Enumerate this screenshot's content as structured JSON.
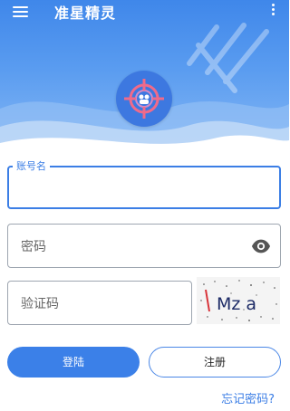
{
  "app": {
    "title": "准星精灵"
  },
  "icons": {
    "menu": "hamburger-menu-icon",
    "more": "more-vertical-icon",
    "logo": "crosshair-icon",
    "eye": "eye-icon"
  },
  "colors": {
    "primary": "#3b80e8",
    "header_top": "#3f87ea",
    "header_bottom": "#86b8f4",
    "field_border": "#9ea6b0"
  },
  "form": {
    "account_label": "账号名",
    "password_placeholder": "密码",
    "captcha_placeholder": "验证码",
    "captcha_text": "Mz a"
  },
  "buttons": {
    "login": "登陆",
    "register": "注册"
  },
  "links": {
    "forgot_password": "忘记密码?"
  }
}
